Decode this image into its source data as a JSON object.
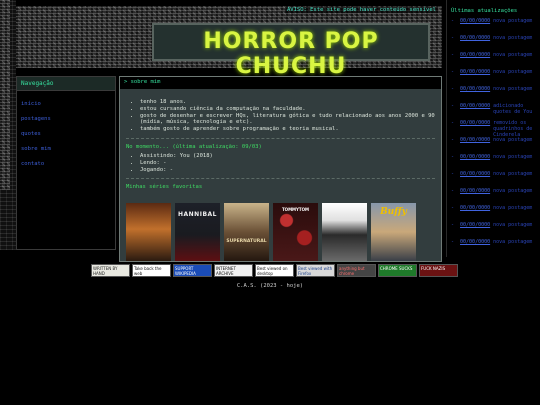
{
  "header": {
    "warning": "AVISO: Este site pode haver conteúdo sensível",
    "logo": "HORROR POP CHUCHU"
  },
  "nav": {
    "title": "Navegação",
    "items": [
      "início",
      "postagens",
      "quotes",
      "sobre mim",
      "contato"
    ]
  },
  "about": {
    "title": "> sobre mim",
    "items": [
      "tenho 18 anos.",
      "estou cursando ciência da computação na faculdade.",
      "gosto de desenhar e escrever HQs, literatura gótica e tudo relacionado aos anos 2000 e 90 (mídia, música, tecnologia e etc).",
      "também gosto de aprender sobre programação e teoria musical."
    ]
  },
  "now": {
    "title": "No momento... (última atualização: 09/03)",
    "items": [
      "Assistindo: You (2018)",
      "Lendo: -",
      "Jogando: -"
    ]
  },
  "series": {
    "title": "Minhas séries favoritas",
    "posters": [
      {
        "label": "",
        "bg": "#7a3b1c"
      },
      {
        "label": "HANNIBAL",
        "bg": "#17191f"
      },
      {
        "label": "SUPERNATURAL",
        "bg": "#4a3a2a"
      },
      {
        "label": "TOMMYTOM",
        "bg": "#3c1414"
      },
      {
        "label": "",
        "bg": "#d9d9d9"
      },
      {
        "label": "Buffy",
        "bg": "#5a6a80"
      }
    ]
  },
  "updates": {
    "title": "Últimas atualizações",
    "items": [
      {
        "date": "00/00/0000",
        "text": "nova postagem"
      },
      {
        "date": "00/00/0000",
        "text": "nova postagem"
      },
      {
        "date": "00/00/0000",
        "text": "nova postagem"
      },
      {
        "date": "00/00/0000",
        "text": "nova postagem"
      },
      {
        "date": "00/00/0000",
        "text": "nova postagem"
      },
      {
        "date": "00/00/0000",
        "text": "adicionado quotes de You"
      },
      {
        "date": "00/00/0000",
        "text": "removido os quadrinhos de Cinderela"
      },
      {
        "date": "00/00/0000",
        "text": "nova postagem"
      },
      {
        "date": "00/00/0000",
        "text": "nova postagem"
      },
      {
        "date": "00/00/0000",
        "text": "nova postagem"
      },
      {
        "date": "00/00/0000",
        "text": "nova postagem"
      },
      {
        "date": "00/00/0000",
        "text": "nova postagem"
      },
      {
        "date": "00/00/0000",
        "text": "nova postagem"
      },
      {
        "date": "00/00/0000",
        "text": "nova postagem"
      }
    ]
  },
  "buttons": [
    {
      "label": "WRITTEN BY HAND",
      "bg": "#e8e8e0",
      "fg": "#222"
    },
    {
      "label": "Take back the web",
      "bg": "#ffffff",
      "fg": "#111"
    },
    {
      "label": "SUPPORT WIKIPEDIA",
      "bg": "#1a4cb8",
      "fg": "#fff"
    },
    {
      "label": "INTERNET ARCHIVE",
      "bg": "#f0f0f0",
      "fg": "#111"
    },
    {
      "label": "Best viewed on desktop",
      "bg": "#ffffff",
      "fg": "#111"
    },
    {
      "label": "Best viewed with Firefox",
      "bg": "#d9d9d9",
      "fg": "#1b3f8a"
    },
    {
      "label": "anything but chrome",
      "bg": "#444",
      "fg": "#ff6e6e"
    },
    {
      "label": "CHROME SUCKS",
      "bg": "#1f7a2a",
      "fg": "#fff"
    },
    {
      "label": "FUCK NAZIS",
      "bg": "#6b1212",
      "fg": "#fff"
    }
  ],
  "footer": "C.A.S. (2023 - hoje)"
}
